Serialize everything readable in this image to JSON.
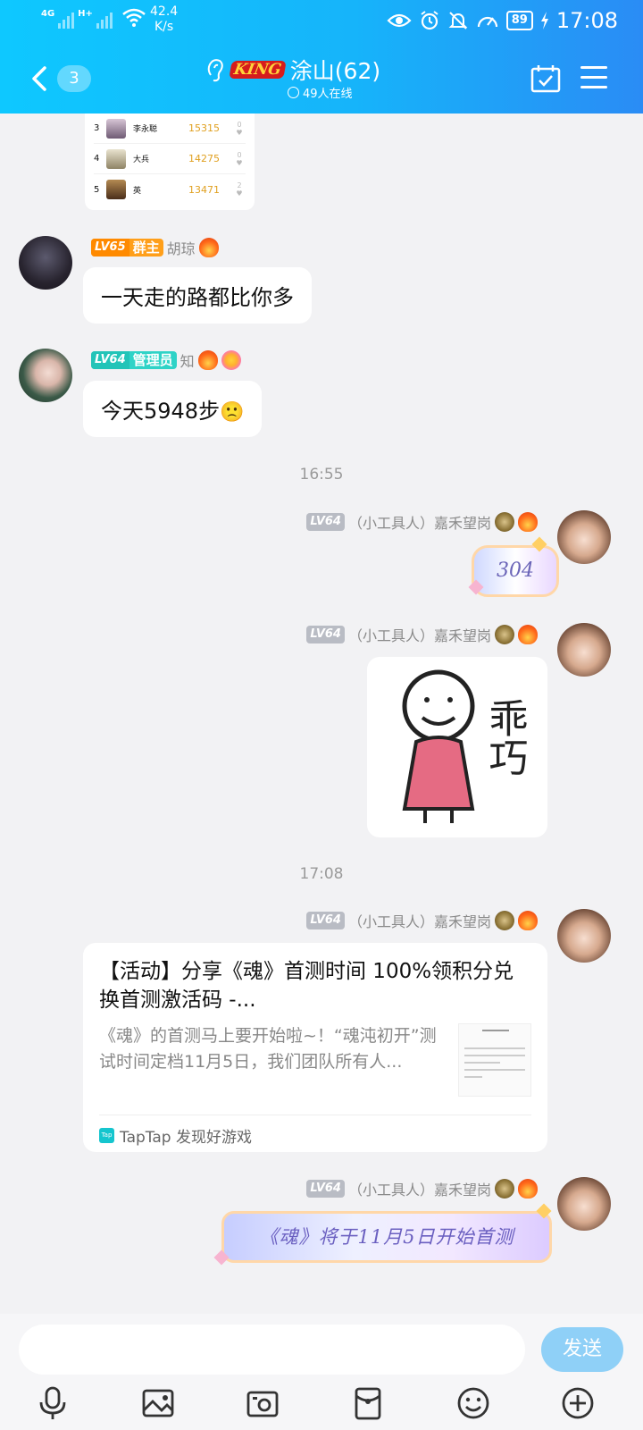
{
  "status_bar": {
    "network_1": "4G",
    "network_2": "H+",
    "speed_value": "42.4",
    "speed_unit": "K/s",
    "battery": "89",
    "time": "17:08"
  },
  "header": {
    "unread_count": "3",
    "group_badge": "KING",
    "title": "涂山(62)",
    "online_status": "49人在线"
  },
  "rank_card": {
    "rows": [
      {
        "rank": "3",
        "name": "李永聪",
        "score": "15315",
        "likes": "0"
      },
      {
        "rank": "4",
        "name": "大兵",
        "score": "14275",
        "likes": "0"
      },
      {
        "rank": "5",
        "name": "英",
        "score": "13471",
        "likes": "2"
      }
    ]
  },
  "messages": {
    "m1": {
      "level": "LV65",
      "role": "群主",
      "name": "胡琼",
      "text": "一天走的路都比你多"
    },
    "m2": {
      "level": "LV64",
      "role": "管理员",
      "name": "知",
      "text": "今天5948步",
      "text_emoji": "🙁"
    },
    "time_1": "16:55",
    "m3": {
      "level": "LV64",
      "name": "（小工具人）嘉禾望岗",
      "sticker_text": "304"
    },
    "m4": {
      "level": "LV64",
      "name": "（小工具人）嘉禾望岗",
      "sticker_text": "乖巧"
    },
    "time_2": "17:08",
    "m5": {
      "level": "LV64",
      "name": "（小工具人）嘉禾望岗",
      "card_title": "【活动】分享《魂》首测时间 100%领积分兑换首测激活码 -...",
      "card_desc": "《魂》的首测马上要开始啦~！“魂沌初开”测试时间定档11月5日，我们团队所有人...",
      "card_source_logo": "Tap",
      "card_source": "TapTap 发现好游戏"
    },
    "m6": {
      "level": "LV64",
      "name": "（小工具人）嘉禾望岗",
      "banner_text": "《魂》将于11月5日开始首测"
    }
  },
  "input": {
    "value": "",
    "send_label": "发送"
  },
  "colors": {
    "header_start": "#0ec8ff",
    "header_end": "#2a8cf5",
    "send_button": "#8fd0f7",
    "owner_badge": "#ff9f1a",
    "admin_badge": "#2fd3c7"
  },
  "toolbar_icons": [
    "microphone-icon",
    "image-icon",
    "camera-icon",
    "red-packet-icon",
    "emoji-icon",
    "plus-icon"
  ]
}
